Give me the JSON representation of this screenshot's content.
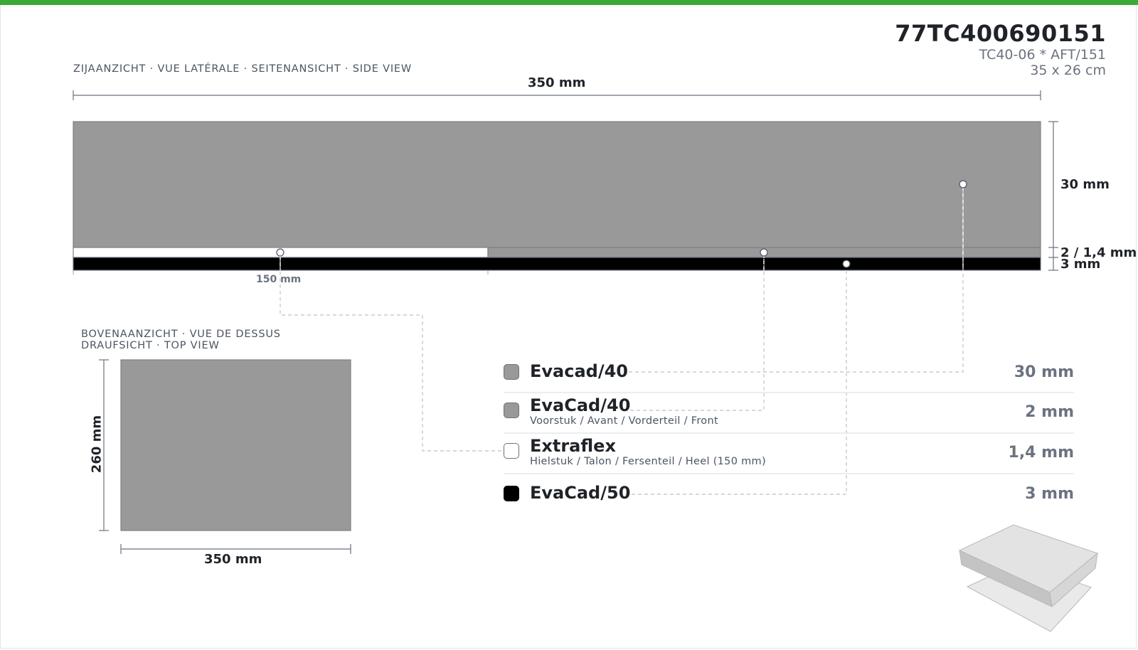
{
  "header": {
    "article_code": "77TC400690151",
    "model": "TC40-06 * AFT/151",
    "size": "35 x 26 cm"
  },
  "side_view": {
    "caption": "ZIJAANZICHT · VUE LATÉRALE · SEITENANSICHT · SIDE VIEW",
    "width_label": "350 mm",
    "heel_label": "150 mm",
    "dim_top": "30 mm",
    "dim_mid": "2 / 1,4 mm",
    "dim_bottom": "3 mm"
  },
  "top_view": {
    "caption_line1": "BOVENAANZICHT · VUE DE DESSUS",
    "caption_line2": "DRAUFSICHT · TOP VIEW",
    "height_label": "260 mm",
    "width_label": "350 mm"
  },
  "materials": [
    {
      "name": "Evacad/40",
      "description": "",
      "thickness": "30 mm",
      "color": "#999999"
    },
    {
      "name": "EvaCad/40",
      "description": "Voorstuk / Avant / Vorderteil / Front",
      "thickness": "2 mm",
      "color": "#999999"
    },
    {
      "name": "Extraflex",
      "description": "Hielstuk / Talon / Fersenteil / Heel (150 mm)",
      "thickness": "1,4 mm",
      "color": "#ffffff"
    },
    {
      "name": "EvaCad/50",
      "description": "",
      "thickness": "3 mm",
      "color": "#000000"
    }
  ],
  "colors": {
    "accent": "#3aa935",
    "layer_grey": "#999999",
    "layer_black": "#000000"
  }
}
